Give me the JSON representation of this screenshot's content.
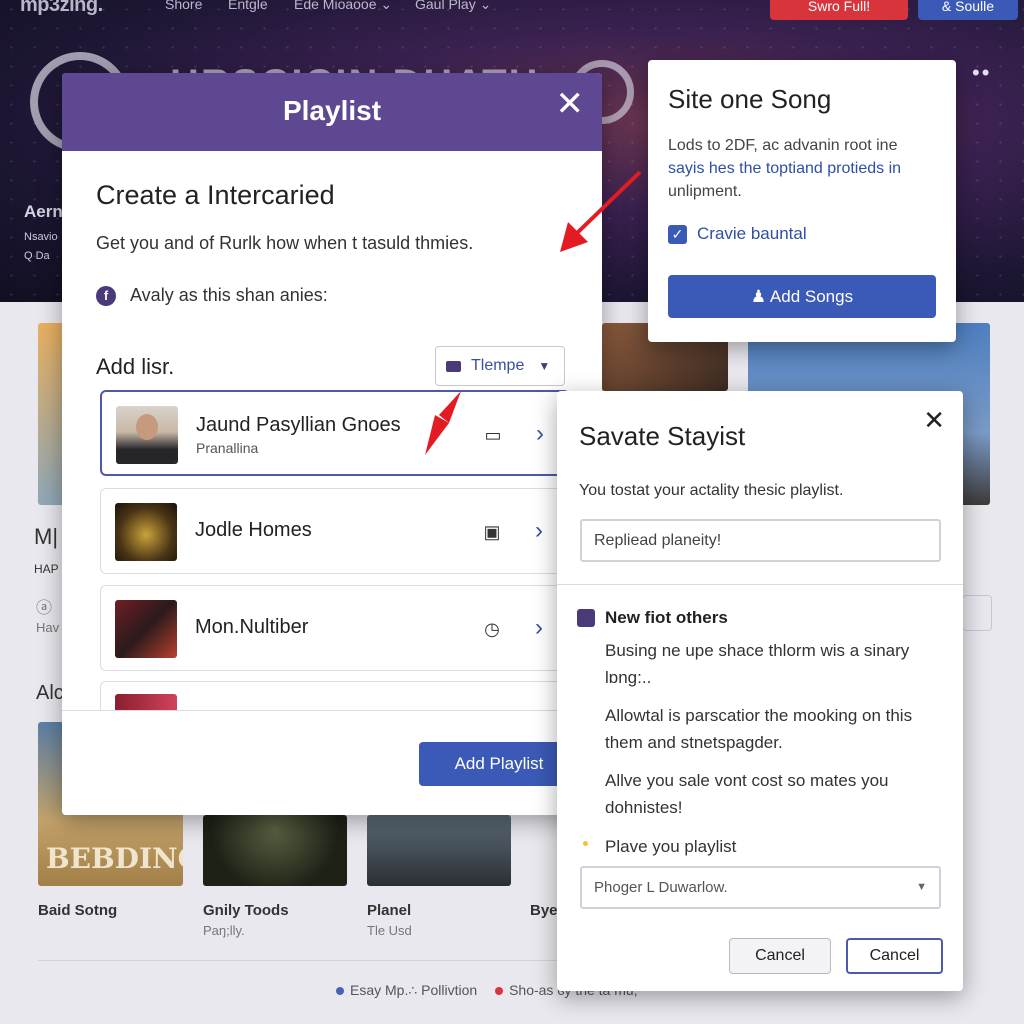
{
  "topnav": {
    "logo": "mp3zing.",
    "links": [
      "Shore",
      "Entgle",
      "Ede Mioaooe ⌄",
      "Gaul Play ⌄"
    ],
    "red_button": "Swro Full!",
    "blue_button": "& Soulle"
  },
  "hero": {
    "title": "HRSCICIN DHATH",
    "side1": "Aern",
    "side2": "Nsavio",
    "side3": "Q Da"
  },
  "background": {
    "left_snippets": [
      "M|",
      "HAP",
      "ⓐ",
      "Hav",
      "Alc"
    ],
    "albums": [
      {
        "title": "Baid Sotng",
        "sub": ""
      },
      {
        "title": "Gnily Toods",
        "sub": "Paŋ;lly."
      },
      {
        "title": "Planel",
        "sub": "Tle Usd"
      },
      {
        "title": "Bye",
        "sub": ""
      }
    ],
    "album_art_text": "BEBDING",
    "footer_left": "Esay Mp.∴ Pollivtion",
    "footer_right": "Sho-as ɞy the ta mu;",
    "colors": {
      "brand_purple": "#5d4891",
      "accent_blue": "#3b59b6",
      "arrow_red": "#e31c23"
    }
  },
  "playlist_dialog": {
    "title": "Playlist",
    "close": "✕",
    "heading": "Create a Intercaried",
    "description": "Get you and of Rurlk how when t tasuld thmies.",
    "info_text": "Avaly as this shan anies:",
    "info_icon": "facebook-icon",
    "add_label": "Add lisr.",
    "template_select": "Tlempe",
    "rows": [
      {
        "name": "Jaund Pasyllian Gnoes",
        "sub": "Pranallina",
        "icon": "video-icon"
      },
      {
        "name": "Jodle Homes",
        "sub": "",
        "icon": "tv-icon"
      },
      {
        "name": "Mon.Nultiber",
        "sub": "",
        "icon": "clock-icon"
      },
      {
        "name": "",
        "sub": "",
        "icon": ""
      }
    ],
    "add_button": "Add Playlist"
  },
  "song_dialog": {
    "title": "Site one Song",
    "text_part1": "Lods to 2DF, ac advanin root ine",
    "text_part2": "sayis hes the toptiand protieds in",
    "text_part3": "unlipment.",
    "checkbox_label": "Cravie bauntal",
    "checkbox_checked": true,
    "add_button": "Add Songs"
  },
  "save_dialog": {
    "title": "Savate Stayist",
    "close": "✕",
    "description": "You tostat your actality thesic playlist.",
    "input_value": "Repliead planeity!",
    "section_title": "New fiot others",
    "paragraph1": "Busing ne upe shace thlorm wis a sinary lɒng:..",
    "paragraph2": "Allowtal is parscatior the mooking on this them and stnetspagder.",
    "paragraph3": "Allve you sale vont cost so mates you dohnistes!",
    "bullet_label": "Plave you playlist",
    "select_value": "Phoger L Duwarlow.",
    "cancel_button_1": "Cancel",
    "cancel_button_2": "Cancel"
  }
}
